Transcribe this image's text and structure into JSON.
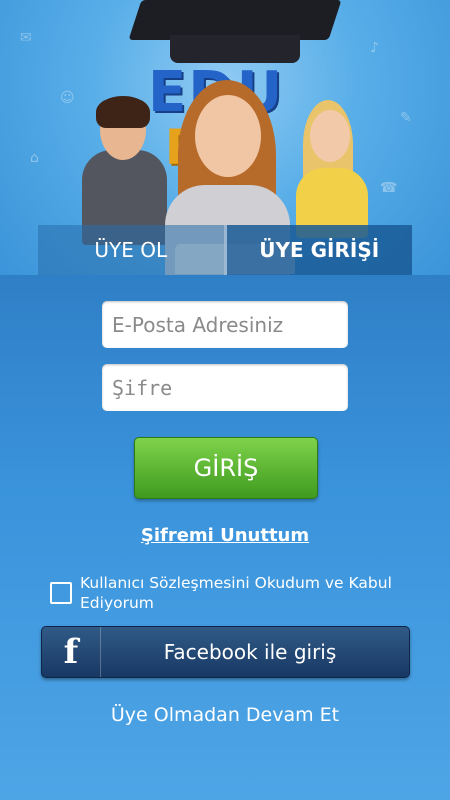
{
  "hero": {
    "logo_top": "EDU",
    "logo_bottom": "RD"
  },
  "tabs": {
    "register": "ÜYE OL",
    "login": "ÜYE GİRİŞİ"
  },
  "form": {
    "email_placeholder": "E-Posta Adresiniz",
    "password_placeholder": "Şifre",
    "login_button": "GİRİŞ",
    "forgot_password": "Şifremi Unuttum",
    "agreement_text": "Kullanıcı Sözleşmesini Okudum ve Kabul Ediyorum"
  },
  "social": {
    "facebook_icon": "f",
    "facebook_label": "Facebook ile giriş"
  },
  "guest": {
    "label": "Üye Olmadan Devam Et"
  },
  "colors": {
    "accent_green": "#4aa82a",
    "facebook_blue": "#1f4572",
    "tab_bg": "#1e5a96"
  }
}
